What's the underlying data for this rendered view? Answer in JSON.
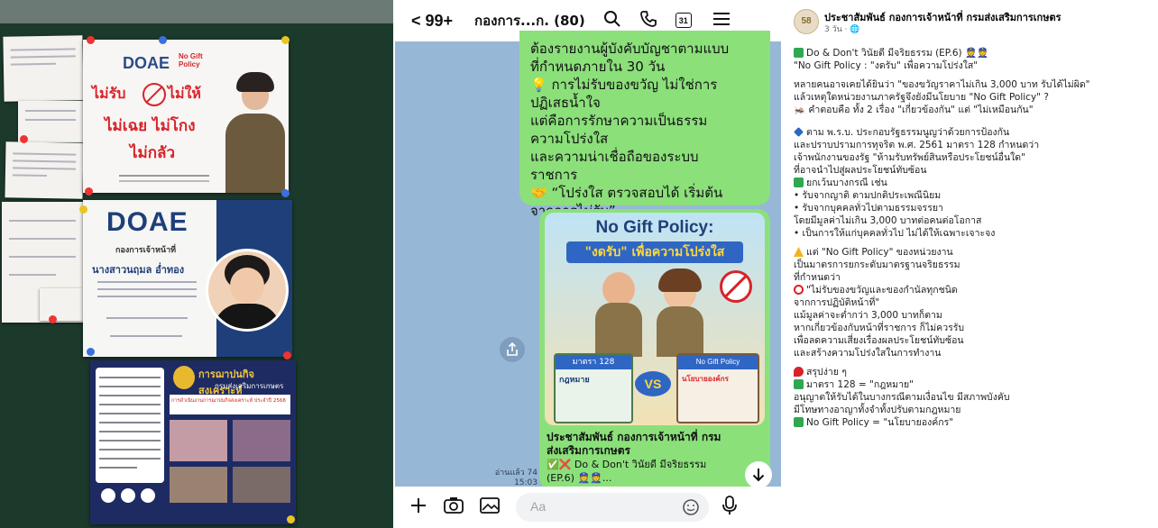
{
  "board": {
    "poster1": {
      "logo": "DOAE",
      "tag": "No Gift Policy",
      "line1": "ไม่รับ",
      "line1b": "ไม่ให้",
      "line2": "ไม่เฉย ไม่โกง",
      "line3": "ไม่กลัว"
    },
    "poster2": {
      "logo": "DOAE",
      "org": "กองการเจ้าหน้าที่",
      "name": "นางสาวนฤมล อ่ำทอง"
    },
    "poster3": {
      "title": "การฌาปนกิจสงเคราะห์",
      "subtitle": "กรมส่งเสริมการเกษตร",
      "award_line": "การดำเนินงานการฌาปนกิจสงเคราะห์ ประจำปี 2568"
    }
  },
  "chat": {
    "back_label": "< 99+",
    "title": "กองการ...ก. (80)",
    "icons": [
      "search-icon",
      "phone-icon",
      "calendar-icon",
      "menu-icon"
    ],
    "calendar_day": "31",
    "message_lines": [
      "ต้องรายงานผู้บังคับบัญชาตามแบบ",
      "ที่กำหนดภายใน 30 วัน",
      "💡 การไม่รับของขวัญ ไม่ใช่การ",
      "ปฏิเสธน้ำใจ",
      "แต่คือการรักษาความเป็นธรรม",
      "ความโปร่งใส",
      "และความน่าเชื่อถือของระบบ",
      "ราชการ",
      "🤝 “โปร่งใส ตรวจสอบได้ เริ่มต้น",
      "จากการไม่รับ”"
    ],
    "card": {
      "headline": "No Gift Policy:",
      "subheadline": "\"งดรับ\" เพื่อความโปร่งใส",
      "sign_left": "มาตรา 128",
      "sign_left_sub": "กฎหมาย",
      "vs": "VS",
      "sign_right": "No Gift Policy",
      "sign_right_sub": "นโยบายองค์กร",
      "caption1": "ประชาสัมพันธ์ กองการเจ้าหน้าที่ กรม",
      "caption2": "ส่งเสริมการเกษตร",
      "caption3": "✅❌ Do & Don't วินัยดี มีจริยธรรม",
      "caption4": "(EP.6) 👮👮..."
    },
    "read_label": "อ่านแล้ว 74",
    "time": "15:03",
    "input_placeholder": "Aa"
  },
  "post": {
    "page_name": "ประชาสัมพันธ์ กองการเจ้าหน้าที่ กรมส่งเสริมการเกษตร",
    "meta": "3 วัน · 🌐",
    "avatar_text": "58",
    "lines": [
      "Do & Don't วินัยดี มีจริยธรรม (EP.6) 👮👮",
      "\"No Gift Policy : \"งดรับ\" เพื่อความโปร่งใส\"",
      " หลายคนอาจเคยได้ยินว่า \"ของขวัญราคาไม่เกิน 3,000 บาท รับได้ไม่ผิด\"",
      "แล้วเหตุใดหน่วยงานภาครัฐจึงยังมีนโยบาย \"No Gift Policy\" ?",
      "🦗 คำตอบคือ ทั้ง 2 เรื่อง \"เกี่ยวข้องกัน\" แต่ \"ไม่เหมือนกัน\"",
      "ตาม พ.ร.บ. ประกอบรัฐธรรมนูญว่าด้วยการป้องกัน",
      "และปราบปรามการทุจริต พ.ศ. 2561 มาตรา 128 กำหนดว่า",
      "เจ้าพนักงานของรัฐ \"ห้ามรับทรัพย์สินหรือประโยชน์อื่นใด\"",
      "ที่อาจนำไปสู่ผลประโยชน์ทับซ้อน",
      "ยกเว้นบางกรณี เช่น",
      "• รับจากญาติ ตามปกติประเพณีนิยม",
      "• รับจากบุคคลทั่วไปตามธรรมจรรยา",
      "โดยมีมูลค่าไม่เกิน 3,000 บาทต่อคนต่อโอกาส",
      "• เป็นการให้แก่บุคคลทั่วไป ไม่ได้ให้เฉพาะเจาะจง",
      "แต่ \"No Gift Policy\" ของหน่วยงาน",
      "เป็นมาตรการยกระดับมาตรฐานจริยธรรม",
      "ที่กำหนดว่า",
      "\"ไม่รับของขวัญและของกำนัลทุกชนิด",
      "จากการปฏิบัติหน้าที่\"",
      "แม้มูลค่าจะต่ำกว่า 3,000 บาทก็ตาม",
      "หากเกี่ยวข้องกับหน้าที่ราชการ ก็ไม่ควรรับ",
      "เพื่อลดความเสี่ยงเรื่องผลประโยชน์ทับซ้อน",
      "และสร้างความโปร่งใสในการทำงาน",
      "สรุปง่าย ๆ",
      "มาตรา 128 = \"กฎหมาย\"",
      "อนุญาตให้รับได้ในบางกรณีตามเงื่อนไข มีสภาพบังคับ",
      "มีโทษทางอาญาทั้งจำทั้งปรับตามกฎหมาย",
      "No Gift Policy = \"นโยบายองค์กร\""
    ],
    "line_icons": [
      "check-x-icon",
      "",
      "",
      "",
      "",
      "diamond-icon",
      "",
      "",
      "",
      "check-icon",
      "",
      "",
      "",
      "",
      "warning-icon",
      "",
      "",
      "no-entry-icon",
      "",
      "",
      "",
      "",
      "",
      "pin-icon",
      "check-icon",
      "",
      "",
      "check-icon"
    ]
  },
  "colors": {
    "board_green": "#1c3a2c",
    "chat_bg": "#97b7d6",
    "bubble_green": "#8be07a",
    "red_brand": "#d8232a",
    "navy_brand": "#1f3f7a",
    "fb_check": "#2fa84f"
  }
}
